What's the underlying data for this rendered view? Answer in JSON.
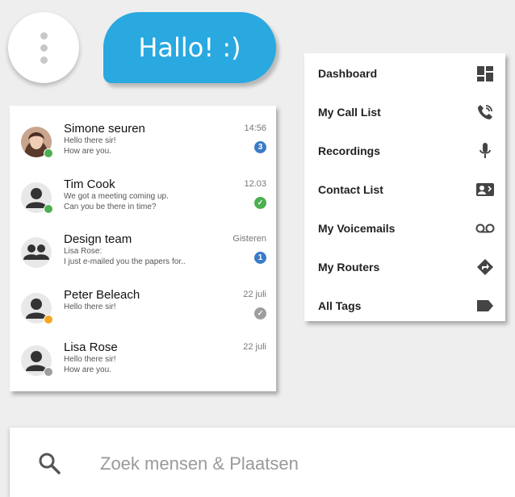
{
  "greeting": {
    "text": "Hallo! :)"
  },
  "chats": [
    {
      "name": "Simone seuren",
      "line1": "Hello there sir!",
      "line2": "How are you.",
      "time": "14:56",
      "badge": "3",
      "badge_color": "#3b7cc7",
      "status_color": "#4caf50",
      "avatar": "photo"
    },
    {
      "name": "Tim Cook",
      "line1": "We got a meeting coming up.",
      "line2": "Can you be there in time?",
      "time": "12.03",
      "badge": "✓",
      "badge_color": "#4caf50",
      "status_color": "#4caf50",
      "avatar": "person"
    },
    {
      "name": "Design team",
      "line1": "Lisa Rose:",
      "line2": "I just e-mailed you the papers for..",
      "time": "Gisteren",
      "badge": "1",
      "badge_color": "#3b7cc7",
      "status_color": "",
      "avatar": "group"
    },
    {
      "name": "Peter Beleach",
      "line1": "Hello there sir!",
      "line2": "",
      "time": "22 juli",
      "badge": "✓",
      "badge_color": "#9e9e9e",
      "status_color": "#f5a623",
      "avatar": "person"
    },
    {
      "name": "Lisa Rose",
      "line1": "Hello there sir!",
      "line2": "How are you.",
      "time": "22 juli",
      "badge": "",
      "badge_color": "",
      "status_color": "#9e9e9e",
      "avatar": "person"
    }
  ],
  "nav": [
    {
      "label": "Dashboard",
      "icon": "dashboard-icon"
    },
    {
      "label": "My Call List",
      "icon": "phone-call-icon"
    },
    {
      "label": "Recordings",
      "icon": "microphone-icon"
    },
    {
      "label": "Contact List",
      "icon": "contact-card-icon"
    },
    {
      "label": "My Voicemails",
      "icon": "voicemail-icon"
    },
    {
      "label": "My Routers",
      "icon": "directions-icon"
    },
    {
      "label": "All Tags",
      "icon": "tag-icon"
    }
  ],
  "search": {
    "placeholder": "Zoek mensen & Plaatsen"
  }
}
